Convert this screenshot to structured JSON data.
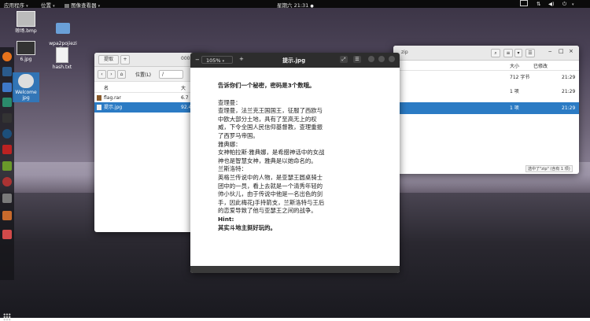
{
  "topbar": {
    "apps": "应用程序",
    "places": "位置",
    "viewer_app": "图像查看器",
    "clock": "星期六 21:31"
  },
  "desktop_icons": [
    {
      "label": "晾场.bmp"
    },
    {
      "label": "wpa2pojiezi\ndian"
    },
    {
      "label": "6.jpg"
    },
    {
      "label": "hash.txt"
    },
    {
      "label": "Welcome"
    },
    {
      "label": "jpg"
    }
  ],
  "file_manager_left": {
    "extract_label": "提取",
    "add_label": "+",
    "partial_title": "000",
    "location_label": "位置(L)",
    "path": "/",
    "col_name": "名",
    "col_size": "大",
    "files": [
      {
        "name": "flag.rar",
        "size": "6.7"
      },
      {
        "name": "提示.jpg",
        "size": "92.4"
      }
    ]
  },
  "file_manager_right": {
    "partial_title": "zip",
    "col_size": "大小",
    "col_modified": "已修改",
    "rows": [
      {
        "size": "712 字节",
        "time": "21:29"
      },
      {
        "size": "1 项",
        "time": "21:29"
      },
      {
        "size": "1 项",
        "time": "21:29"
      }
    ],
    "status": "选中了\"zip\" (含有 1 项)"
  },
  "image_viewer": {
    "zoom": "105%",
    "title": "提示.jpg",
    "content": [
      {
        "text": "告诉你们一个秘密，密码是3个数哦。",
        "bold": true,
        "gap_after": true
      },
      {
        "text": "查理曼：",
        "bold": false
      },
      {
        "text": "查理曼，法兰克王国国王，征服了西欧与中欧大部分土地，具有了至高无上的权威，下令全国人民信仰基督教，查理重振了西罗马帝国。",
        "bold": false
      },
      {
        "text": "雅典娜：",
        "bold": false
      },
      {
        "text": "女神帕拉斯·雅典娜，是希腊神话中的女战神也是智慧女神，雅典是以她命名的。",
        "bold": false
      },
      {
        "text": "兰斯洛特：",
        "bold": false
      },
      {
        "text": "英格兰传说中的人物，是亚瑟王圆桌骑士团中的一员，看上去就是一个清秀年轻的帅小伙儿，由于传说中他是一名出色的剑手，因此梅花J手持箭支，兰斯洛特与王后的恋爱导致了他与亚瑟王之间的战争。",
        "bold": false
      },
      {
        "text": "Hint:",
        "bold": true
      },
      {
        "text": "其实斗地主挺好玩的。",
        "bold": true
      }
    ]
  },
  "colors": {
    "selection": "#2b7bc4",
    "header_bar": "#2d2d2d",
    "window_bg": "#ffffff",
    "sidebar_bg": "#f6f6f6"
  }
}
